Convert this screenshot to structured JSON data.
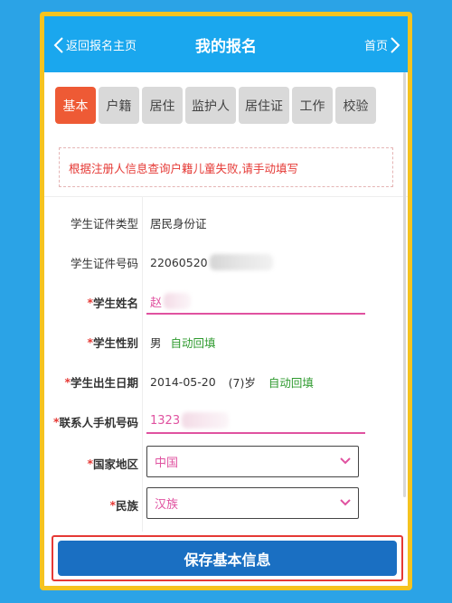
{
  "header": {
    "back_label": "返回报名主页",
    "title": "我的报名",
    "home_label": "首页"
  },
  "tabs": [
    {
      "label": "基本",
      "active": true
    },
    {
      "label": "户籍",
      "active": false
    },
    {
      "label": "居住",
      "active": false
    },
    {
      "label": "监护人",
      "active": false
    },
    {
      "label": "居住证",
      "active": false
    },
    {
      "label": "工作",
      "active": false
    },
    {
      "label": "校验",
      "active": false
    }
  ],
  "notice": "根据注册人信息查询户籍儿童失败,请手动填写",
  "form": {
    "id_type": {
      "label": "学生证件类型",
      "value": "居民身份证"
    },
    "id_number": {
      "label": "学生证件号码",
      "value": "22060520"
    },
    "name": {
      "required_mark": "*",
      "label": "学生姓名",
      "value": "赵"
    },
    "gender": {
      "required_mark": "*",
      "label": "学生性别",
      "value": "男",
      "auto": "自动回填"
    },
    "birth": {
      "required_mark": "*",
      "label": "学生出生日期",
      "value": "2014-05-20",
      "age": "(7)岁",
      "auto": "自动回填"
    },
    "phone": {
      "required_mark": "*",
      "label": "联系人手机号码",
      "value": "1323"
    },
    "country": {
      "required_mark": "*",
      "label": "国家地区",
      "value": "中国"
    },
    "ethnicity": {
      "required_mark": "*",
      "label": "民族",
      "value": "汉族"
    }
  },
  "save_label": "保存基本信息",
  "colors": {
    "header_bg": "#1aa7ee",
    "active_tab": "#ee5a35",
    "save_button": "#1a6fc2",
    "accent_pink": "#e052a0",
    "auto_fill_green": "#2e9a2e",
    "warning_red": "#e53935"
  }
}
